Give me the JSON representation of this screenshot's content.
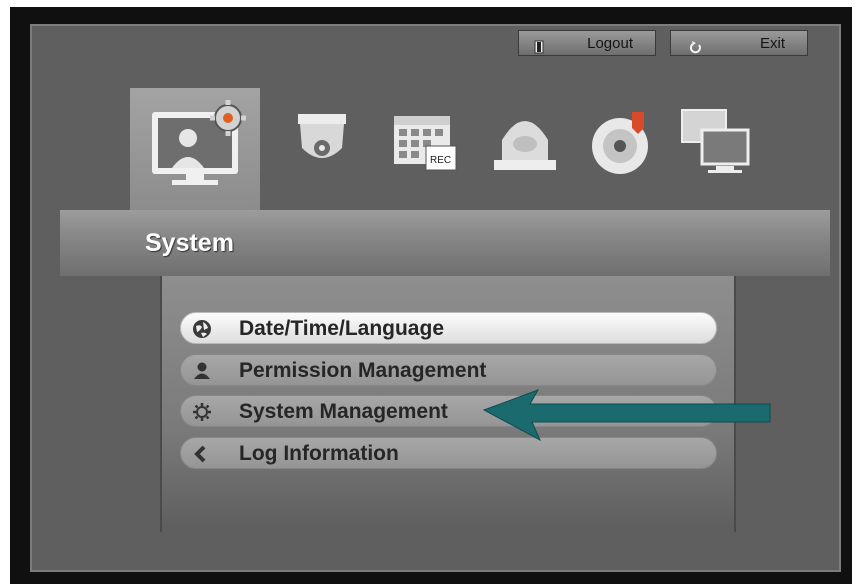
{
  "buttons": {
    "logout": "Logout",
    "exit": "Exit"
  },
  "categories": [
    {
      "name": "system-settings-icon",
      "selected": true
    },
    {
      "name": "camera-icon",
      "selected": false
    },
    {
      "name": "record-schedule-icon",
      "selected": false
    },
    {
      "name": "event-alarm-icon",
      "selected": false
    },
    {
      "name": "backup-disc-icon",
      "selected": false
    },
    {
      "name": "network-icon",
      "selected": false
    }
  ],
  "section": {
    "title": "System"
  },
  "menu": {
    "items": [
      {
        "label": "Date/Time/Language",
        "icon": "globe-icon",
        "selected": true
      },
      {
        "label": "Permission Management",
        "icon": "user-icon",
        "selected": false
      },
      {
        "label": "System Management",
        "icon": "gear-icon",
        "selected": false
      },
      {
        "label": "Log Information",
        "icon": "log-icon",
        "selected": false
      }
    ]
  },
  "colors": {
    "arrow": "#1a6a6e",
    "panel": "#5f5f5f",
    "selected_item": "#f2f2f2"
  }
}
